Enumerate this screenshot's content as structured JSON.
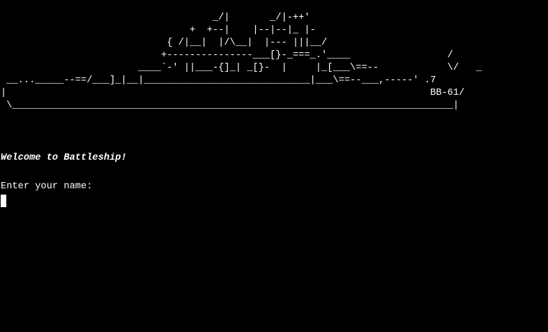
{
  "terminal": {
    "ascii_art": "                                     _/|       _/|-++'\n                                 +  +--|    |--|--|_ |-\n                             { /|__|  |/\\__|  |--- |||__/\n                            +---------------___[}-_===_.'____                 /\n                        ____`-' ||___-{]_| _[}-  |     |_[___\\==--            \\/   _\n __..._____--==/___]_|__|_____________________________|___\\==--___,-----' .7\n|                                                                          BB-61/\n \\_____________________________________________________________________________|",
    "welcome_message": "Welcome to Battleship!",
    "prompt_text": "Enter your name:",
    "colors": {
      "background": "#000000",
      "foreground": "#ffffff"
    }
  }
}
